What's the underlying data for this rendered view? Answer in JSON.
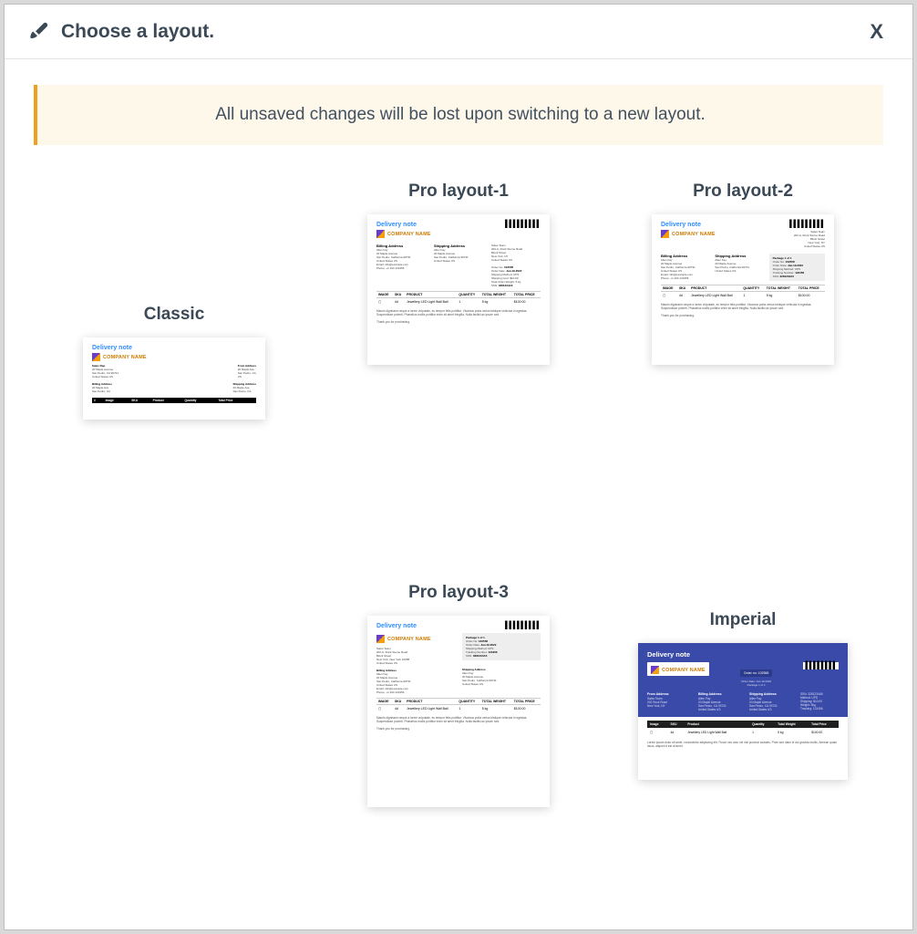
{
  "header": {
    "title": "Choose a layout.",
    "close_label": "X"
  },
  "warning": "All unsaved changes will be lost upon switching to a new layout.",
  "layouts": {
    "classic": {
      "label": "Classic"
    },
    "pro1": {
      "label": "Pro layout-1"
    },
    "pro2": {
      "label": "Pro layout-2"
    },
    "pro3": {
      "label": "Pro layout-3"
    },
    "imperial": {
      "label": "Imperial"
    }
  },
  "preview": {
    "doc_title": "Delivery note",
    "company_name": "COMPANY NAME",
    "order_no_label": "Order no",
    "order_no": "102558",
    "table_headers": [
      "IMAGE",
      "SKU",
      "PRODUCT",
      "QUANTITY",
      "TOTAL WEIGHT",
      "TOTAL PRICE"
    ],
    "table_headers_short": [
      "Image",
      "SKU",
      "Product",
      "Quantity",
      "Total Weight",
      "Total Price"
    ],
    "line_item": {
      "sku": "4d",
      "product": "Jewellery LED Light Wall Ball",
      "qty": "1",
      "weight": "5 kg",
      "price": "$100.00"
    },
    "sections": {
      "billing": "Billing Address",
      "shipping": "Shipping Address",
      "from": "From Address"
    },
    "package_label": "Package 1 of 1",
    "thanks": "Thank you for purchasing."
  }
}
